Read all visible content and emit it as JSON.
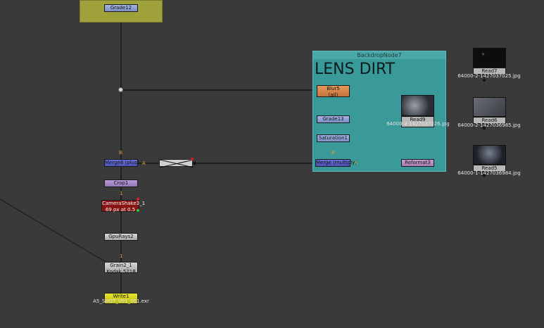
{
  "colors": {
    "canvas": "#3a3a3a",
    "backdrop_yellow": "#9fa23a",
    "backdrop_teal": "#3a9a9a",
    "wire": "#111111",
    "pipe_label": "#e0a23a"
  },
  "backdrop": {
    "title": "BackdropNode7",
    "label": "LENS DIRT"
  },
  "nodes": {
    "grade12": "Grade12",
    "blur5": "Blur5",
    "blur5_sub": "(all)",
    "grade13": "Grade13",
    "saturation1": "Saturation1",
    "merge_left": "Merge8 (plus)",
    "merge_right": "Merge (multiply)",
    "crop1": "Crop1",
    "camerashake": "CameraShake3_1",
    "camerashake_sub": "69 px at 0.5",
    "gpurays": "GpuRays2",
    "grain": "Grain2_1",
    "grain_sub": "Kodak 5218",
    "write": "Write1",
    "write_sub": "A5_SHOT_V01_001.exr",
    "read9": "Read9",
    "read9_file": "64000-3-1427037026.jpg",
    "reformat3": "Reformat3",
    "read7": "Read7",
    "read7_file": "64000-2-1427037025.jpg",
    "read6": "Read6",
    "read6_file": "64000-2-1427036985.jpg",
    "read5": "Read5",
    "read5_file": "64000-1-1427036984.jpg"
  },
  "pipes": {
    "B": "B",
    "A": "A",
    "one": "1"
  }
}
